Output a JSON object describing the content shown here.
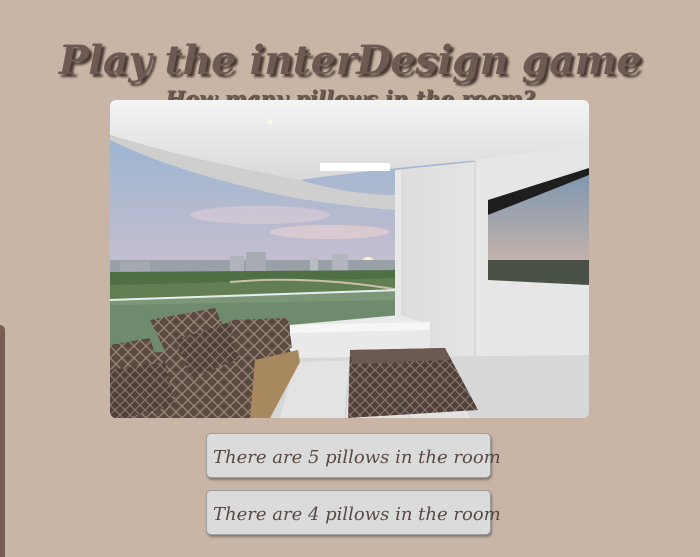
{
  "game": {
    "title": "Play the interDesign game",
    "question": "How many pillows in the room?"
  },
  "image": {
    "icon": "balcony-room-photo"
  },
  "answers": [
    {
      "label": "There are 5 pillows in the room"
    },
    {
      "label": "There are 4 pillows in the room"
    }
  ],
  "colors": {
    "background": "#c9b5a5",
    "title": "#6e5a52",
    "button": "#dbdbdb"
  }
}
